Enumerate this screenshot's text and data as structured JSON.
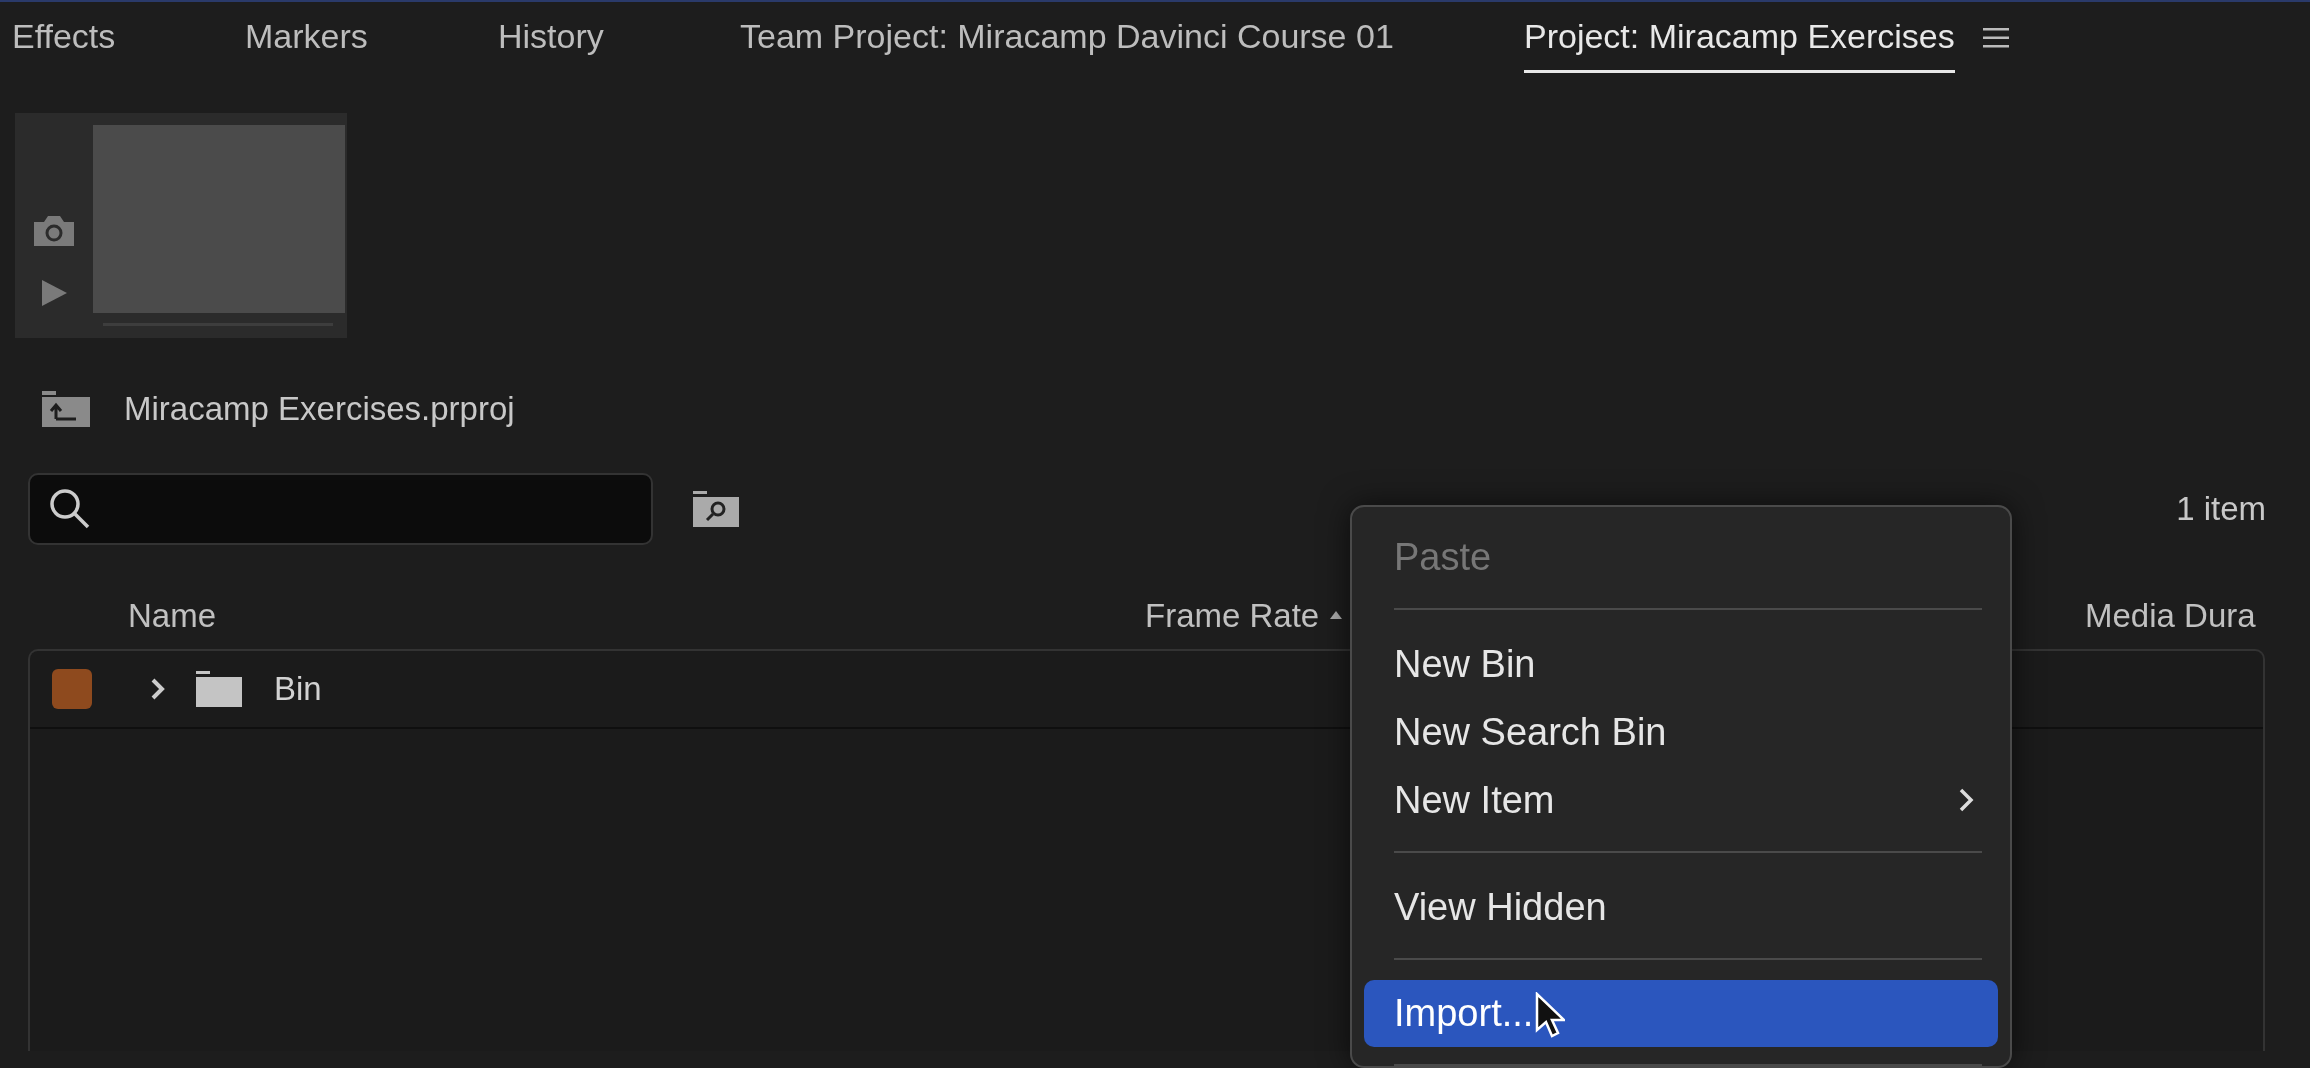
{
  "tabs": [
    {
      "label": "Effects",
      "selected": false
    },
    {
      "label": "Markers",
      "selected": false
    },
    {
      "label": "History",
      "selected": false
    },
    {
      "label": "Team Project: Miracamp Davinci Course 01",
      "selected": false
    },
    {
      "label": "Project: Miracamp Exercises",
      "selected": true
    }
  ],
  "project": {
    "path": "Miracamp Exercises.prproj",
    "item_count": "1 item"
  },
  "table": {
    "columns": [
      "Name",
      "Frame Rate",
      "Media Dura"
    ],
    "rows": [
      {
        "name": "Bin",
        "color": "#8e4a1e",
        "expanded": false
      }
    ]
  },
  "context_menu": {
    "items": [
      {
        "kind": "item",
        "label": "Paste",
        "disabled": true,
        "selected": false,
        "submenu": false
      },
      {
        "kind": "separator"
      },
      {
        "kind": "item",
        "label": "New Bin",
        "disabled": false,
        "selected": false,
        "submenu": false
      },
      {
        "kind": "item",
        "label": "New Search Bin",
        "disabled": false,
        "selected": false,
        "submenu": false
      },
      {
        "kind": "item",
        "label": "New Item",
        "disabled": false,
        "selected": false,
        "submenu": true
      },
      {
        "kind": "separator"
      },
      {
        "kind": "item",
        "label": "View Hidden",
        "disabled": false,
        "selected": false,
        "submenu": false
      },
      {
        "kind": "separator"
      },
      {
        "kind": "item",
        "label": "Import...",
        "disabled": false,
        "selected": true,
        "submenu": false
      },
      {
        "kind": "separator"
      }
    ]
  }
}
